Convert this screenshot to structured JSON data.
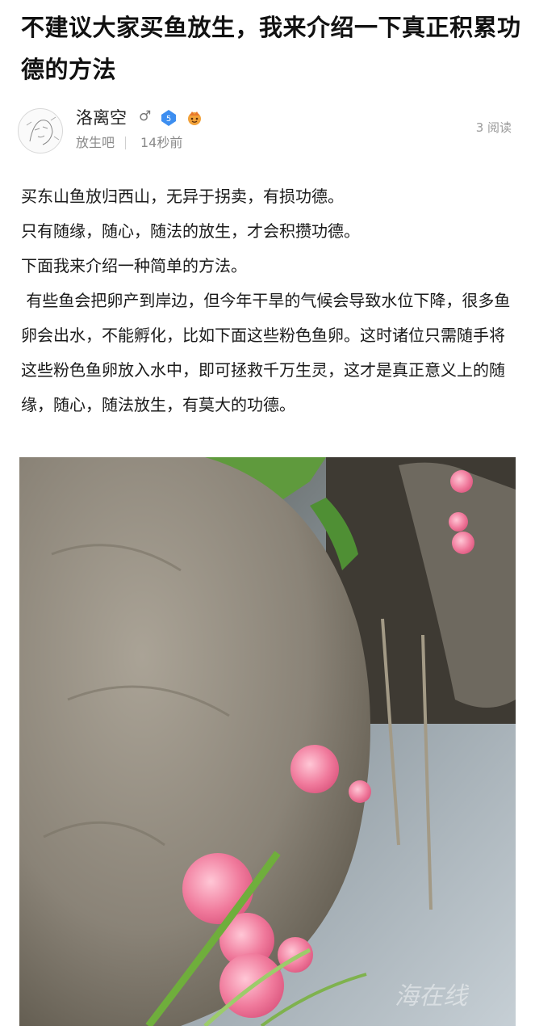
{
  "post": {
    "title": "不建议大家买鱼放生，我来介绍一下真正积累功德的方法",
    "author": {
      "name": "洛离空",
      "gender_icon": "♂",
      "level": "5",
      "forum": "放生吧",
      "time": "14秒前"
    },
    "read_count": "3 阅读",
    "paragraphs": [
      "买东山鱼放归西山，无异于拐卖，有损功德。",
      "只有随缘，随心，随法的放生，才会积攒功德。",
      "下面我来介绍一种简单的方法。",
      " 有些鱼会把卵产到岸边，但今年干旱的气候会导致水位下降，很多鱼卵会出水，不能孵化，比如下面这些粉色鱼卵。这时诸位只需随手将这些粉色鱼卵放入水中，即可拯救千万生灵，这才是真正意义上的随缘，随心，随法放生，有莫大的功德。"
    ],
    "image": {
      "subject": "pink-eggs-on-rock-photo",
      "watermark": "海在线"
    }
  },
  "colors": {
    "egg_pink": "#f06c93",
    "rock_gray": "#8c8579",
    "water": "#b9c4cc",
    "grass": "#4f8f34"
  }
}
